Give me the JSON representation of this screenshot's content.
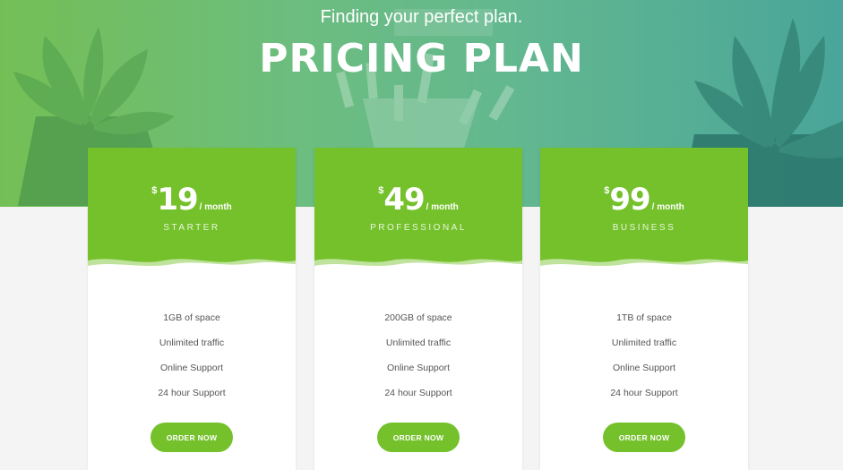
{
  "header": {
    "subtitle": "Finding your perfect plan.",
    "title": "PRICING PLAN"
  },
  "colors": {
    "accent_green": "#74c12b",
    "hero_gradient_start": "#74bf55",
    "hero_gradient_end": "#4aa59a",
    "background": "#f4f4f4"
  },
  "plans": [
    {
      "currency": "$",
      "price": "19",
      "period": "/ month",
      "name": "STARTER",
      "features": [
        "1GB of space",
        "Unlimited traffic",
        "Online Support",
        "24 hour Support"
      ],
      "button_label": "ORDER NOW"
    },
    {
      "currency": "$",
      "price": "49",
      "period": "/ month",
      "name": "PROFESSIONAL",
      "features": [
        "200GB of space",
        "Unlimited traffic",
        "Online Support",
        "24 hour Support"
      ],
      "button_label": "ORDER NOW"
    },
    {
      "currency": "$",
      "price": "99",
      "period": "/ month",
      "name": "BUSINESS",
      "features": [
        "1TB of space",
        "Unlimited traffic",
        "Online Support",
        "24 hour Support"
      ],
      "button_label": "ORDER NOW"
    }
  ]
}
